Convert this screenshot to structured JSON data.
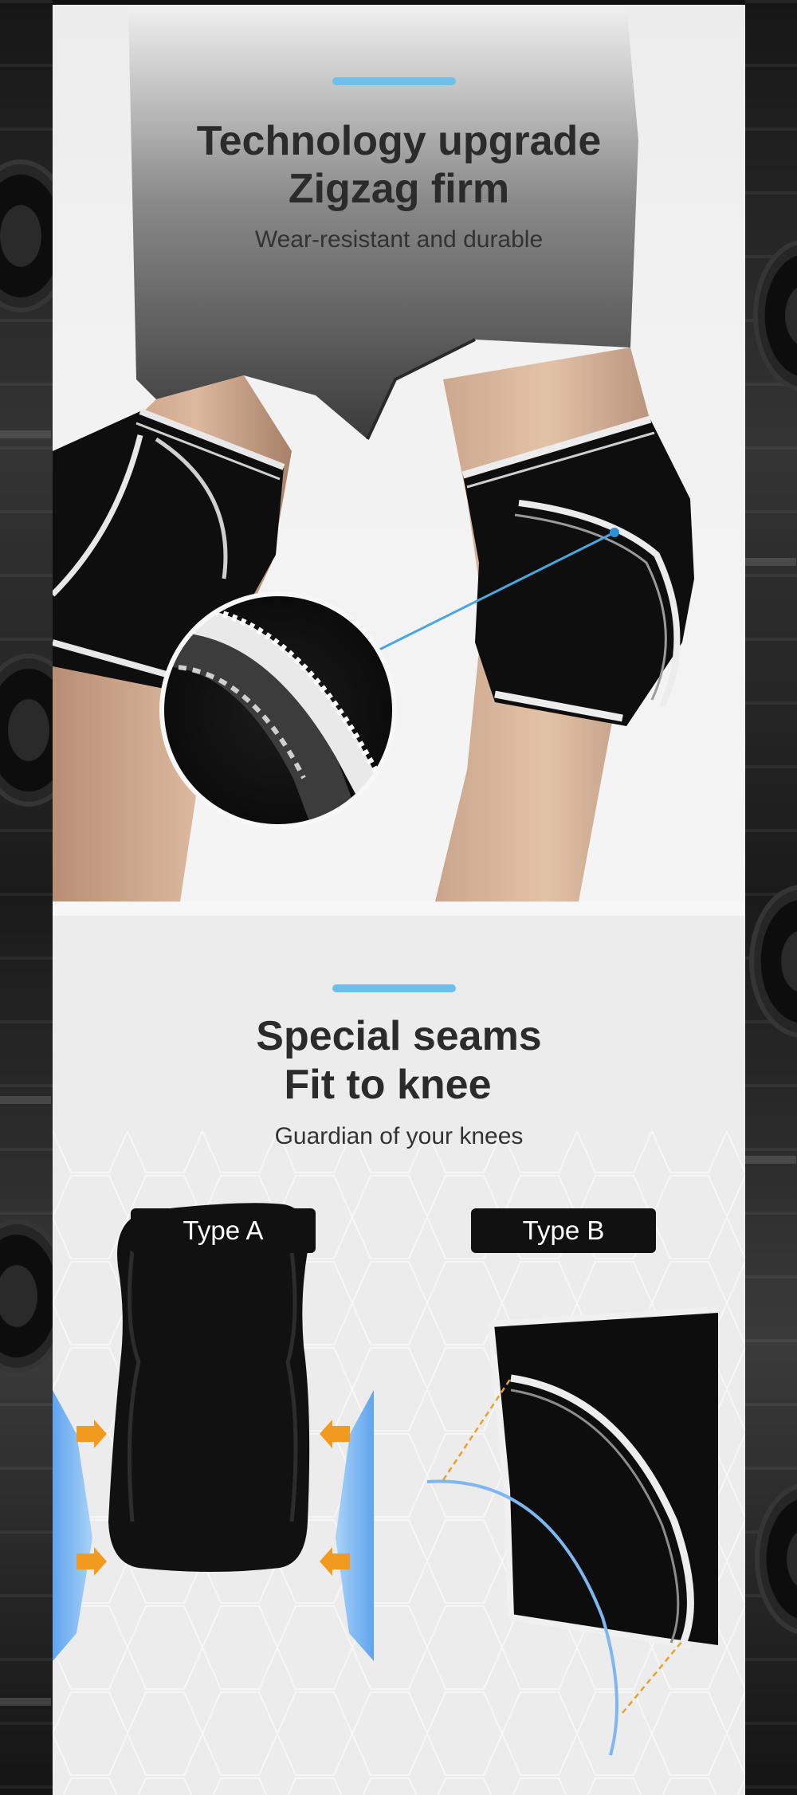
{
  "section_top": {
    "title_line1": "Technology upgrade",
    "title_line2": "Zigzag firm",
    "subtitle": "Wear-resistant and durable"
  },
  "section_bottom": {
    "title_line1": "Special seams",
    "title_line2": "Fit to knee",
    "subtitle": "Guardian of your knees",
    "type_a_label": "Type A",
    "type_b_label": "Type B"
  },
  "colors": {
    "accent": "#6cc0ea",
    "arrow": "#f29a1e",
    "guide_line": "#e7a12c",
    "shape_blue": "#7eb6f0",
    "product_black": "#101010",
    "seam_white": "#f5f5f5"
  },
  "icons": {
    "arrow": "arrow-right-icon",
    "zoom": "stitch-detail-zoom"
  }
}
